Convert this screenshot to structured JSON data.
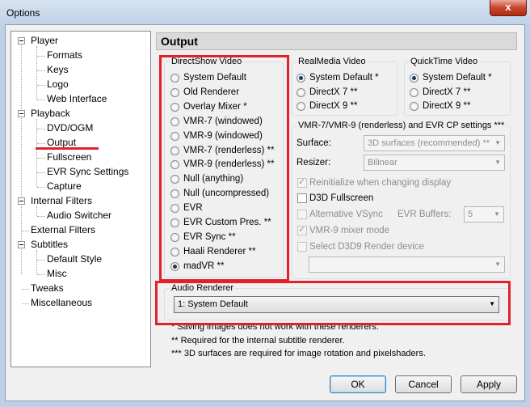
{
  "window": {
    "title": "Options",
    "close_glyph": "x"
  },
  "tree": {
    "player": "Player",
    "formats": "Formats",
    "keys": "Keys",
    "logo": "Logo",
    "web_interface": "Web Interface",
    "playback": "Playback",
    "dvd_ogm": "DVD/OGM",
    "output": "Output",
    "fullscreen": "Fullscreen",
    "evr_sync": "EVR Sync Settings",
    "capture": "Capture",
    "internal_filters": "Internal Filters",
    "audio_switcher": "Audio Switcher",
    "external_filters": "External Filters",
    "subtitles": "Subtitles",
    "default_style": "Default Style",
    "misc": "Misc",
    "tweaks": "Tweaks",
    "miscellaneous": "Miscellaneous"
  },
  "page_title": "Output",
  "directshow": {
    "label": "DirectShow Video",
    "options": [
      "System Default",
      "Old Renderer",
      "Overlay Mixer *",
      "VMR-7 (windowed)",
      "VMR-9 (windowed)",
      "VMR-7 (renderless) **",
      "VMR-9 (renderless) **",
      "Null (anything)",
      "Null (uncompressed)",
      "EVR",
      "EVR Custom Pres. **",
      "EVR Sync **",
      "Haali Renderer **",
      "madVR **"
    ],
    "selected": "madVR **"
  },
  "realmedia": {
    "label": "RealMedia Video",
    "options": [
      "System Default *",
      "DirectX 7 **",
      "DirectX 9 **"
    ],
    "selected": "System Default *"
  },
  "quicktime": {
    "label": "QuickTime Video",
    "options": [
      "System Default *",
      "DirectX 7 **",
      "DirectX 9 **"
    ],
    "selected": "System Default *"
  },
  "vmr": {
    "label": "VMR-7/VMR-9 (renderless) and EVR CP settings ***",
    "surface_label": "Surface:",
    "surface_value": "3D surfaces (recommended) **",
    "resizer_label": "Resizer:",
    "resizer_value": "Bilinear",
    "reinit": "Reinitialize when changing display",
    "d3d_fullscreen": "D3D Fullscreen",
    "alt_vsync": "Alternative VSync",
    "evr_buffers_label": "EVR Buffers:",
    "evr_buffers_value": "5",
    "vmr9_mixer": "VMR-9 mixer mode",
    "select_d3d9": "Select D3D9 Render device",
    "device_value": ""
  },
  "audio": {
    "label": "Audio Renderer",
    "value": "1: System Default"
  },
  "notes": [
    "* Saving images does not work with these renderers.",
    "** Required for the internal subtitle renderer.",
    "*** 3D surfaces are required for image rotation and pixelshaders."
  ],
  "buttons": {
    "ok": "OK",
    "cancel": "Cancel",
    "apply": "Apply"
  },
  "colors": {
    "highlight_red": "#e3202c"
  }
}
